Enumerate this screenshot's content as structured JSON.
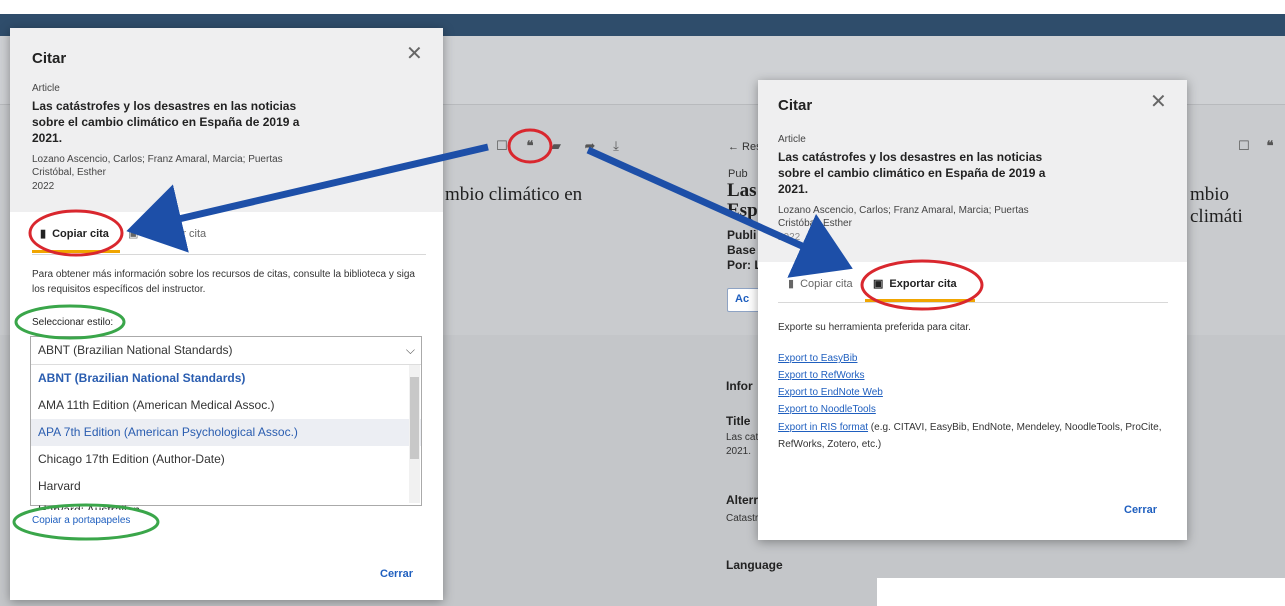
{
  "background": {
    "heading_left": "mbio climático en",
    "heading_right_1": "Las",
    "heading_right_2": "Esp",
    "heading_right_3": "mbio climáti",
    "back_link": "← Res",
    "pub_label": "Pub",
    "publi_label": "Publi",
    "base_label": "Base d",
    "por_label": "Por: L",
    "info_label": "Infor",
    "title_label": "Title",
    "title_value_1": "Las cat",
    "title_value_2": "2021.",
    "alter_label": "Alterr",
    "alter_value": "Catastr",
    "language_label": "Language",
    "action_btn": "Ac"
  },
  "left_dialog": {
    "title": "Citar",
    "close_icon": "close-icon",
    "type": "Article",
    "article_title_lines": [
      "Las catástrofes y los desastres en las noticias",
      "sobre el cambio climático en España de 2019 a",
      "2021."
    ],
    "authors_lines": [
      "Lozano Ascencio, Carlos; Franz Amaral, Marcia; Puertas",
      "Cristóbal, Esther"
    ],
    "year": "2022",
    "tabs": [
      {
        "label": "Copiar cita",
        "active": true,
        "icon": "copy-icon"
      },
      {
        "label": "Exportar cita",
        "active": false,
        "icon": "export-icon"
      }
    ],
    "info_lines": [
      "Para obtener más información sobre los recursos de citas, consulte la biblioteca y siga",
      "los requisitos específicos del instructor."
    ],
    "style_label": "Seleccionar estilo:",
    "select_value": "ABNT (Brazilian National Standards)",
    "options": [
      "ABNT (Brazilian National Standards)",
      "AMA 11th Edition (American Medical Assoc.)",
      "APA 7th Edition (American Psychological Assoc.)",
      "Chicago 17th Edition (Author-Date)",
      "Harvard",
      "Harvard: Australian"
    ],
    "copy_link": "Copiar a portapapeles",
    "close_button": "Cerrar"
  },
  "right_dialog": {
    "title": "Citar",
    "type": "Article",
    "article_title_lines": [
      "Las catástrofes y los desastres en las noticias",
      "sobre el cambio climático en España de 2019 a",
      "2021."
    ],
    "authors_lines": [
      "Lozano Ascencio, Carlos; Franz Amaral, Marcia; Puertas",
      "Cristóbal, Esther"
    ],
    "year": "2022",
    "tabs": [
      {
        "label": "Copiar cita",
        "active": false
      },
      {
        "label": "Exportar cita",
        "active": true
      }
    ],
    "intro": "Exporte su herramienta preferida para citar.",
    "links": [
      "Export to EasyBib",
      "Export to RefWorks",
      "Export to EndNote Web",
      "Export to NoodleTools"
    ],
    "ris_link": "Export in RIS format",
    "ris_note_1": " (e.g. CITAVI, EasyBib, EndNote, Mendeley, NoodleTools, ProCite,",
    "ris_note_2": "RefWorks, Zotero, etc.)",
    "close_button": "Cerrar"
  },
  "annotation_colors": {
    "red": "#d9272e",
    "green": "#3aa64a",
    "blue": "#1d4fa8",
    "accent": "#f0a500"
  }
}
